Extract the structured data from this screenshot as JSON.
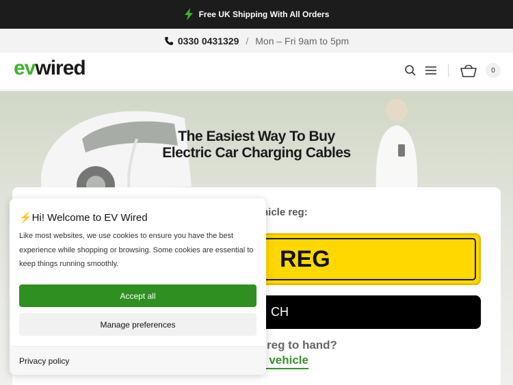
{
  "announcement": {
    "text": "Free UK Shipping With All Orders",
    "icon": "lightning-icon",
    "accent": "#3db32b"
  },
  "contact": {
    "phone": "0330 0431329",
    "separator": "/",
    "hours": "Mon – Fri 9am to 5pm"
  },
  "header": {
    "logo_ev": "ev",
    "logo_wired": "wired",
    "cart_count": "0"
  },
  "hero": {
    "title_line1": "The Easiest Way To Buy",
    "title_line2": "Electric Car Charging Cables"
  },
  "vehicle_finder": {
    "prompt": "hicle reg:",
    "reg_placeholder": "REG",
    "search_label": "CH",
    "no_reg_text": "reg to hand?",
    "choose_link": "r vehicle"
  },
  "cookie_banner": {
    "title": "⚡Hi! Welcome to EV Wired",
    "body": "Like most websites, we use cookies to ensure you have the best experience while shopping or browsing. Some cookies are essential to keep things running smoothly.",
    "accept_label": "Accept all",
    "manage_label": "Manage preferences",
    "privacy_label": "Privacy policy",
    "accept_color": "#2f8f21"
  }
}
